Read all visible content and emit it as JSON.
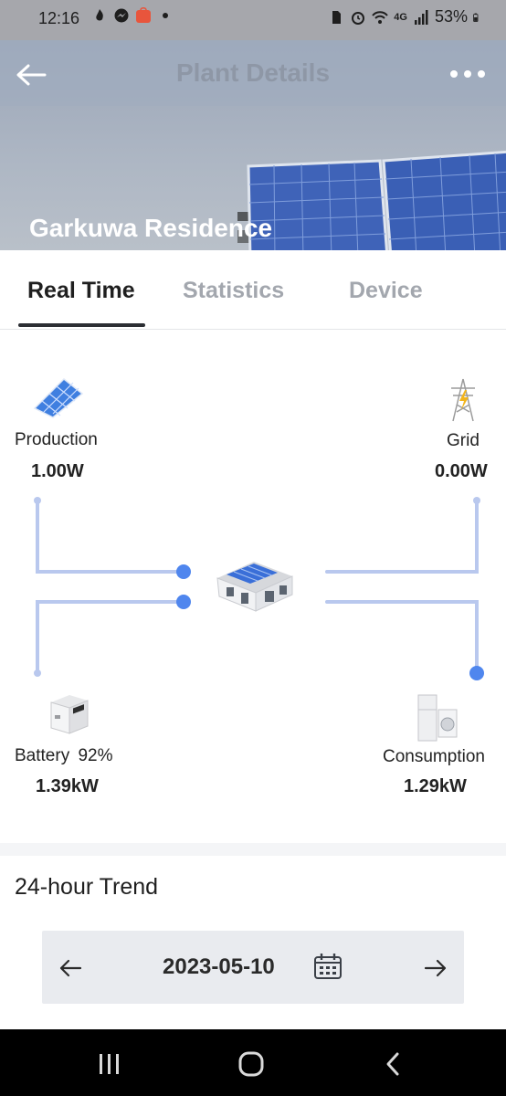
{
  "status_bar": {
    "time": "12:16",
    "battery_percent": "53%",
    "network": "4G",
    "left_icons": [
      "fire-app-icon",
      "messenger-icon",
      "aliexpress-icon",
      "dot-icon"
    ],
    "right_icons": [
      "sim-icon",
      "alarm-icon",
      "wifi-icon",
      "signal-icon",
      "battery-icon"
    ]
  },
  "header": {
    "title": "Plant Details",
    "plant_name": "Garkuwa Residence"
  },
  "tabs": [
    {
      "label": "Real Time",
      "active": true
    },
    {
      "label": "Statistics",
      "active": false
    },
    {
      "label": "Device",
      "active": false
    }
  ],
  "flow": {
    "production": {
      "label": "Production",
      "value": "1.00W"
    },
    "grid": {
      "label": "Grid",
      "value": "0.00W"
    },
    "battery": {
      "label": "Battery",
      "soc": "92%",
      "value": "1.39kW"
    },
    "consumption": {
      "label": "Consumption",
      "value": "1.29kW"
    }
  },
  "trend": {
    "title": "24-hour Trend",
    "date": "2023-05-10"
  },
  "colors": {
    "flow_line": "#b9c8ee",
    "flow_dot": "#4f86ee",
    "status_bar": "#a6a7ac",
    "nav_bar": "#000000"
  }
}
